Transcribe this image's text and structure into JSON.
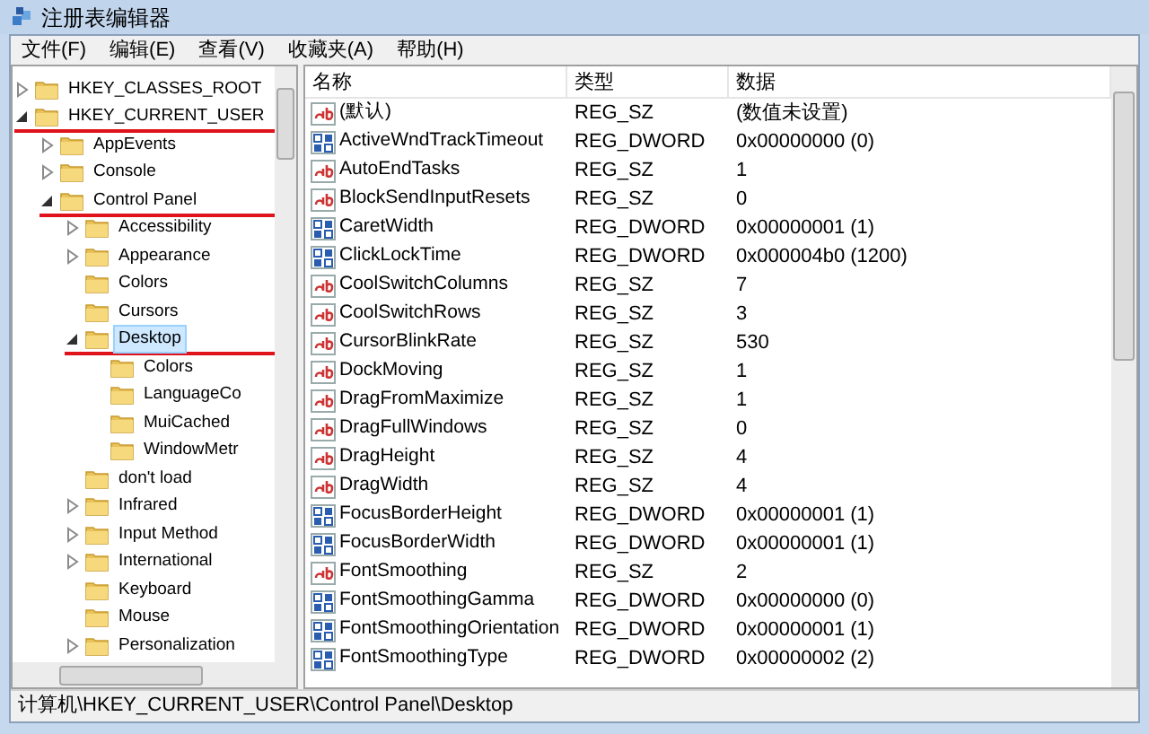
{
  "window": {
    "title": "注册表编辑器"
  },
  "menu": [
    "文件(F)",
    "编辑(E)",
    "查看(V)",
    "收藏夹(A)",
    "帮助(H)"
  ],
  "tree": [
    {
      "label": "HKEY_CLASSES_ROOT",
      "kind": "node",
      "expanded": false,
      "selected": false,
      "marked": false
    },
    {
      "label": "HKEY_CURRENT_USER",
      "kind": "node",
      "expanded": true,
      "selected": false,
      "marked": true,
      "children": [
        {
          "label": "AppEvents",
          "kind": "node",
          "expanded": false,
          "selected": false,
          "marked": false
        },
        {
          "label": "Console",
          "kind": "node",
          "expanded": false,
          "selected": false,
          "marked": false
        },
        {
          "label": "Control Panel",
          "kind": "node",
          "expanded": true,
          "selected": false,
          "marked": true,
          "children": [
            {
              "label": "Accessibility",
              "kind": "node",
              "expanded": false,
              "selected": false,
              "marked": false
            },
            {
              "label": "Appearance",
              "kind": "node",
              "expanded": false,
              "selected": false,
              "marked": false
            },
            {
              "label": "Colors",
              "kind": "leaf",
              "expanded": false,
              "selected": false,
              "marked": false
            },
            {
              "label": "Cursors",
              "kind": "leaf",
              "expanded": false,
              "selected": false,
              "marked": false
            },
            {
              "label": "Desktop",
              "kind": "node",
              "expanded": true,
              "selected": true,
              "marked": true,
              "children": [
                {
                  "label": "Colors",
                  "kind": "leaf",
                  "expanded": false,
                  "selected": false,
                  "marked": false
                },
                {
                  "label": "LanguageCo",
                  "kind": "leaf",
                  "expanded": false,
                  "selected": false,
                  "marked": false
                },
                {
                  "label": "MuiCached",
                  "kind": "leaf",
                  "expanded": false,
                  "selected": false,
                  "marked": false
                },
                {
                  "label": "WindowMetr",
                  "kind": "leaf",
                  "expanded": false,
                  "selected": false,
                  "marked": false
                }
              ]
            },
            {
              "label": "don't load",
              "kind": "leaf",
              "expanded": false,
              "selected": false,
              "marked": false
            },
            {
              "label": "Infrared",
              "kind": "node",
              "expanded": false,
              "selected": false,
              "marked": false
            },
            {
              "label": "Input Method",
              "kind": "node",
              "expanded": false,
              "selected": false,
              "marked": false
            },
            {
              "label": "International",
              "kind": "node",
              "expanded": false,
              "selected": false,
              "marked": false
            },
            {
              "label": "Keyboard",
              "kind": "leaf",
              "expanded": false,
              "selected": false,
              "marked": false
            },
            {
              "label": "Mouse",
              "kind": "leaf",
              "expanded": false,
              "selected": false,
              "marked": false
            },
            {
              "label": "Personalization",
              "kind": "node",
              "expanded": false,
              "selected": false,
              "marked": false
            }
          ]
        }
      ]
    }
  ],
  "table": {
    "columns": [
      "名称",
      "类型",
      "数据"
    ],
    "rows": [
      {
        "kind": "string",
        "name": "(默认)",
        "type": "REG_SZ",
        "data": "(数值未设置)"
      },
      {
        "kind": "dword",
        "name": "ActiveWndTrackTimeout",
        "type": "REG_DWORD",
        "data": "0x00000000 (0)"
      },
      {
        "kind": "string",
        "name": "AutoEndTasks",
        "type": "REG_SZ",
        "data": "1"
      },
      {
        "kind": "string",
        "name": "BlockSendInputResets",
        "type": "REG_SZ",
        "data": "0"
      },
      {
        "kind": "dword",
        "name": "CaretWidth",
        "type": "REG_DWORD",
        "data": "0x00000001 (1)"
      },
      {
        "kind": "dword",
        "name": "ClickLockTime",
        "type": "REG_DWORD",
        "data": "0x000004b0 (1200)"
      },
      {
        "kind": "string",
        "name": "CoolSwitchColumns",
        "type": "REG_SZ",
        "data": "7"
      },
      {
        "kind": "string",
        "name": "CoolSwitchRows",
        "type": "REG_SZ",
        "data": "3"
      },
      {
        "kind": "string",
        "name": "CursorBlinkRate",
        "type": "REG_SZ",
        "data": "530"
      },
      {
        "kind": "string",
        "name": "DockMoving",
        "type": "REG_SZ",
        "data": "1"
      },
      {
        "kind": "string",
        "name": "DragFromMaximize",
        "type": "REG_SZ",
        "data": "1"
      },
      {
        "kind": "string",
        "name": "DragFullWindows",
        "type": "REG_SZ",
        "data": "0"
      },
      {
        "kind": "string",
        "name": "DragHeight",
        "type": "REG_SZ",
        "data": "4"
      },
      {
        "kind": "string",
        "name": "DragWidth",
        "type": "REG_SZ",
        "data": "4"
      },
      {
        "kind": "dword",
        "name": "FocusBorderHeight",
        "type": "REG_DWORD",
        "data": "0x00000001 (1)"
      },
      {
        "kind": "dword",
        "name": "FocusBorderWidth",
        "type": "REG_DWORD",
        "data": "0x00000001 (1)"
      },
      {
        "kind": "string",
        "name": "FontSmoothing",
        "type": "REG_SZ",
        "data": "2"
      },
      {
        "kind": "dword",
        "name": "FontSmoothingGamma",
        "type": "REG_DWORD",
        "data": "0x00000000 (0)"
      },
      {
        "kind": "dword",
        "name": "FontSmoothingOrientation",
        "type": "REG_DWORD",
        "data": "0x00000001 (1)"
      },
      {
        "kind": "dword",
        "name": "FontSmoothingType",
        "type": "REG_DWORD",
        "data": "0x00000002 (2)"
      }
    ]
  },
  "status_bar": "计算机\\HKEY_CURRENT_USER\\Control Panel\\Desktop"
}
